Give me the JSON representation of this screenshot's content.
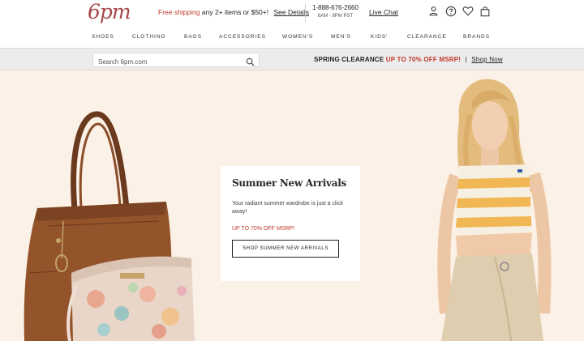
{
  "header": {
    "logo": "6pm",
    "promo_red": "Free shipping",
    "promo_text": "any 2+ items or $50+!",
    "promo_link": "See Details",
    "phone": "1-888-676-2660",
    "hours": "8AM - 8PM PST",
    "live_chat": "Live Chat",
    "icons": [
      "account-icon",
      "help-icon",
      "heart-icon",
      "cart-icon"
    ]
  },
  "nav": {
    "items": [
      "SHOES",
      "CLOTHING",
      "BAGS",
      "ACCESSORIES",
      "WOMEN'S",
      "MEN'S",
      "KIDS'",
      "CLEARANCE",
      "BRANDS"
    ]
  },
  "search": {
    "placeholder": "Search 6pm.com"
  },
  "banner": {
    "label": "SPRING CLEARANCE",
    "offer": "UP TO 70% OFF MSRP!",
    "separator": "|",
    "link": "Shop Now"
  },
  "hero": {
    "title": "Summer New Arrivals",
    "body": "Your radiant summer wardrobe is just a click away!",
    "offer": "UP TO 70% OFF MSRP!",
    "cta": "SHOP SUMMER NEW ARRIVALS"
  },
  "colors": {
    "brand": "#a8464a",
    "accent_red": "#c0392b",
    "hero_bg": "#fbf1e6",
    "strip_bg": "#ececec"
  }
}
